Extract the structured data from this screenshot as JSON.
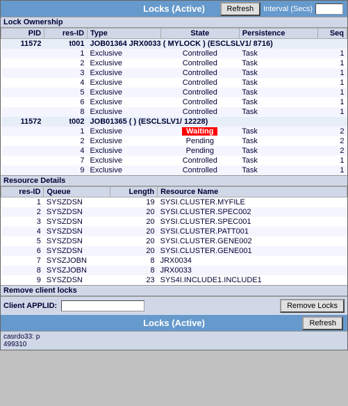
{
  "header": {
    "title": "Locks (Active)",
    "refresh_label": "Refresh",
    "interval_label": "Interval (Secs)",
    "interval_value": ""
  },
  "lock_ownership": {
    "section_label": "Lock Ownership",
    "columns": [
      "PID",
      "res-ID",
      "Type",
      "State",
      "Persistence",
      "Seq"
    ],
    "rows": [
      {
        "type": "job",
        "pid": "11572",
        "res_id": "t001",
        "desc": "JOB01364  JRX0033 ( MYLOCK ) (ESCLSLV1/ 8716)"
      },
      {
        "type": "data",
        "res_id": "1",
        "type_val": "Exclusive",
        "state": "Controlled",
        "persistence": "Task",
        "seq": "1"
      },
      {
        "type": "data",
        "res_id": "2",
        "type_val": "Exclusive",
        "state": "Controlled",
        "persistence": "Task",
        "seq": "1"
      },
      {
        "type": "data",
        "res_id": "3",
        "type_val": "Exclusive",
        "state": "Controlled",
        "persistence": "Task",
        "seq": "1"
      },
      {
        "type": "data",
        "res_id": "4",
        "type_val": "Exclusive",
        "state": "Controlled",
        "persistence": "Task",
        "seq": "1"
      },
      {
        "type": "data",
        "res_id": "5",
        "type_val": "Exclusive",
        "state": "Controlled",
        "persistence": "Task",
        "seq": "1"
      },
      {
        "type": "data",
        "res_id": "6",
        "type_val": "Exclusive",
        "state": "Controlled",
        "persistence": "Task",
        "seq": "1"
      },
      {
        "type": "data",
        "res_id": "8",
        "type_val": "Exclusive",
        "state": "Controlled",
        "persistence": "Task",
        "seq": "1"
      },
      {
        "type": "job",
        "pid": "11572",
        "res_id": "t002",
        "desc": "JOB01365 ( ) (ESCLSLV1/ 12228)"
      },
      {
        "type": "data",
        "res_id": "1",
        "type_val": "Exclusive",
        "state": "Waiting",
        "state_style": "waiting",
        "persistence": "Task",
        "seq": "2"
      },
      {
        "type": "data",
        "res_id": "2",
        "type_val": "Exclusive",
        "state": "Pending",
        "persistence": "Task",
        "seq": "2"
      },
      {
        "type": "data",
        "res_id": "4",
        "type_val": "Exclusive",
        "state": "Pending",
        "persistence": "Task",
        "seq": "2"
      },
      {
        "type": "data",
        "res_id": "7",
        "type_val": "Exclusive",
        "state": "Controlled",
        "persistence": "Task",
        "seq": "1"
      },
      {
        "type": "data",
        "res_id": "9",
        "type_val": "Exclusive",
        "state": "Controlled",
        "persistence": "Task",
        "seq": "1"
      }
    ]
  },
  "resource_details": {
    "section_label": "Resource Details",
    "columns": [
      "res-ID",
      "Queue",
      "Length",
      "Resource Name"
    ],
    "rows": [
      {
        "res_id": "1",
        "queue": "SYSZDSN",
        "length": "19",
        "name": "SYSI.CLUSTER.MYFILE"
      },
      {
        "res_id": "2",
        "queue": "SYSZDSN",
        "length": "20",
        "name": "SYSI.CLUSTER.SPEC002"
      },
      {
        "res_id": "3",
        "queue": "SYSZDSN",
        "length": "20",
        "name": "SYSI.CLUSTER.SPEC001"
      },
      {
        "res_id": "4",
        "queue": "SYSZDSN",
        "length": "20",
        "name": "SYSI.CLUSTER.PATT001"
      },
      {
        "res_id": "5",
        "queue": "SYSZDSN",
        "length": "20",
        "name": "SYSI.CLUSTER.GENE002"
      },
      {
        "res_id": "6",
        "queue": "SYSZDSN",
        "length": "20",
        "name": "SYSI.CLUSTER.GENE001"
      },
      {
        "res_id": "7",
        "queue": "SYSZJOBN",
        "length": "8",
        "name": "JRX0034"
      },
      {
        "res_id": "8",
        "queue": "SYSZJOBN",
        "length": "8",
        "name": "JRX0033"
      },
      {
        "res_id": "9",
        "queue": "SYSZDSN",
        "length": "23",
        "name": "SYS4I.INCLUDE1.INCLUDE1"
      }
    ]
  },
  "remove_section": {
    "section_label": "Remove client locks",
    "client_label": "Client APPLID:",
    "client_value": "",
    "client_placeholder": "",
    "remove_btn_label": "Remove Locks"
  },
  "footer": {
    "title": "Locks (Active)",
    "refresh_label": "Refresh"
  },
  "status_bar": {
    "line1": "casrdo33: p",
    "line2": "499310"
  }
}
